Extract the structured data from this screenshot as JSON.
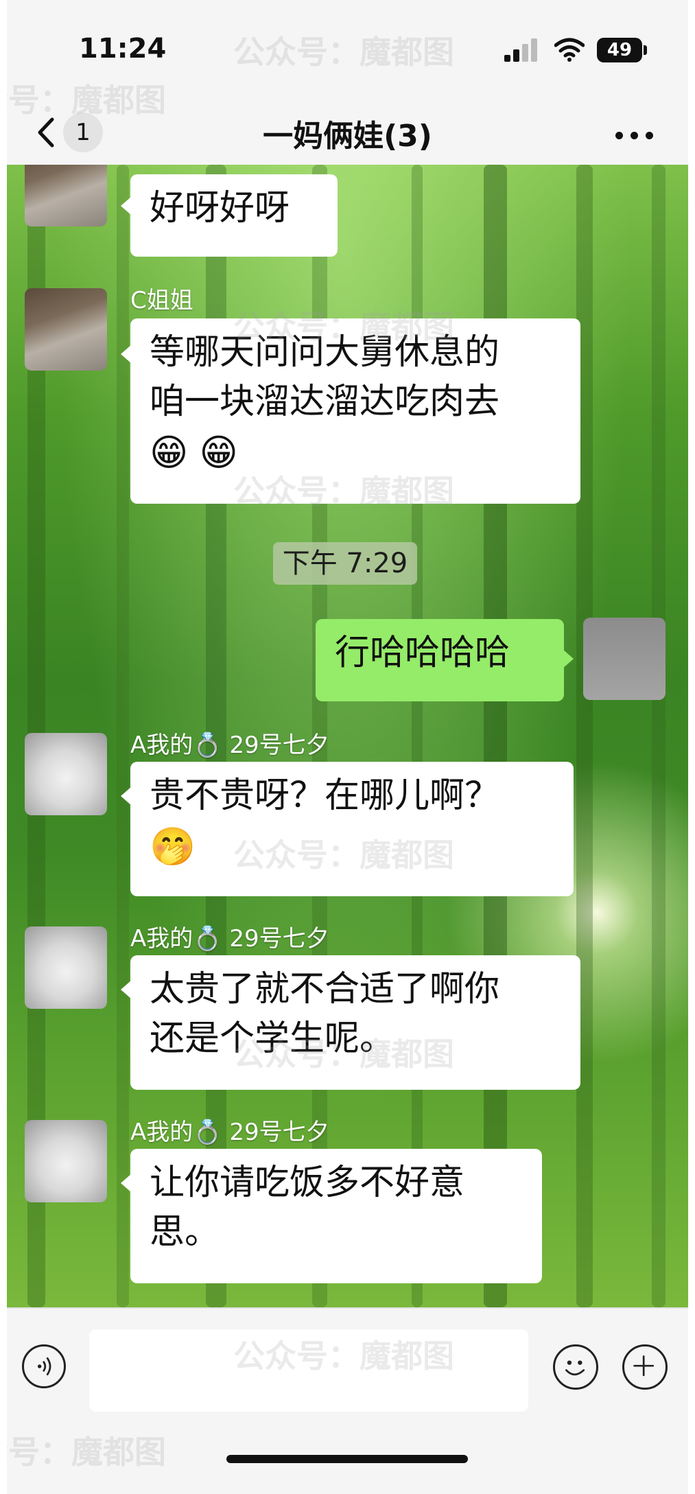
{
  "status_bar": {
    "time": "11:24",
    "battery": "49"
  },
  "nav": {
    "back_count": "1",
    "title": "一妈俩娃(3)"
  },
  "messages": [
    {
      "sender": "",
      "lines": [
        "好呀好呀"
      ],
      "emojis": [],
      "mine": false
    },
    {
      "sender": "C姐姐",
      "lines": [
        "等哪天问问大舅休息的",
        "咱一块溜达溜达吃肉去"
      ],
      "emojis": [
        "😁",
        "😁"
      ],
      "mine": false
    },
    {
      "timestamp": "下午 7:29"
    },
    {
      "sender": "",
      "lines": [
        "行哈哈哈哈"
      ],
      "emojis": [],
      "mine": true
    },
    {
      "sender": "A我的💍 29号七夕",
      "lines": [
        "贵不贵呀？在哪儿啊？"
      ],
      "emojis": [
        "🤭"
      ],
      "mine": false
    },
    {
      "sender": "A我的💍 29号七夕",
      "lines": [
        "太贵了就不合适了啊你",
        "还是个学生呢。"
      ],
      "emojis": [],
      "mine": false
    },
    {
      "sender": "A我的💍 29号七夕",
      "lines": [
        "让你请吃饭多不好意",
        "思。"
      ],
      "emojis": [],
      "mine": false
    }
  ],
  "watermark": {
    "text": "公众号：魔都图"
  },
  "colors": {
    "my_bubble": "#95ec69",
    "other_bubble": "#ffffff",
    "bar_bg": "#f5f5f5"
  }
}
